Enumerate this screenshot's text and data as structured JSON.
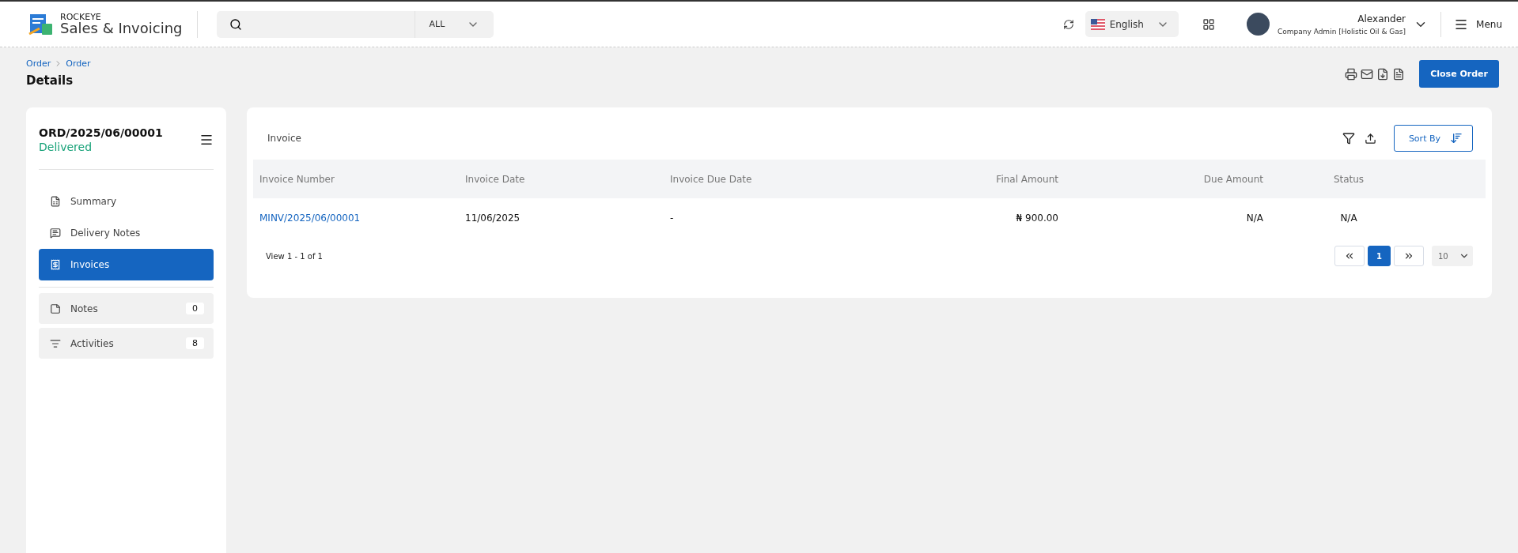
{
  "header": {
    "brand_top": "ROCKEYE",
    "brand_name": "Sales & Invoicing",
    "search": {
      "scope": "ALL"
    },
    "language": "English",
    "user": {
      "name": "Alexander",
      "role": "Company Admin [Holistic Oil & Gas]"
    },
    "menu_label": "Menu"
  },
  "breadcrumb": [
    "Order",
    "Order"
  ],
  "page_title": "Details",
  "close_button": "Close Order",
  "order": {
    "number": "ORD/2025/06/00001",
    "status": "Delivered"
  },
  "sidebar": {
    "items": [
      {
        "label": "Summary",
        "selected": false
      },
      {
        "label": "Delivery Notes",
        "selected": false
      },
      {
        "label": "Invoices",
        "selected": true
      }
    ],
    "counters": [
      {
        "label": "Notes",
        "count": "0"
      },
      {
        "label": "Activities",
        "count": "8"
      }
    ]
  },
  "invoice_panel": {
    "title": "Invoice",
    "sort_label": "Sort By",
    "table": {
      "columns": [
        "Invoice Number",
        "Invoice Date",
        "Invoice Due Date",
        "Final Amount",
        "Due Amount",
        "Status"
      ],
      "rows": [
        [
          "MINV/2025/06/00001",
          "11/06/2025",
          "-",
          "₦ 900.00",
          "N/A",
          "N/A"
        ]
      ]
    },
    "view_count": "View 1 - 1 of 1",
    "pages": [
      {
        "label": "1",
        "selected": true
      }
    ],
    "page_size": "10"
  }
}
